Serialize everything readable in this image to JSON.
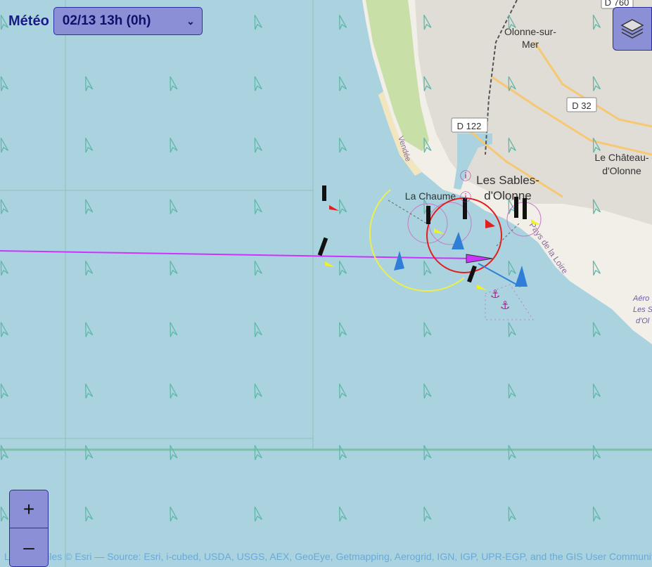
{
  "meteo": {
    "label": "Météo",
    "selected": "02/13 13h (0h)"
  },
  "map": {
    "places": {
      "olonne": "Olonne-sur-",
      "olonne2": "Mer",
      "sables": "Les Sables-",
      "sables2": "d'Olonne",
      "chaume": "La Chaume",
      "chateau": "Le Château-",
      "chateau2": "d'Olonne",
      "vendee": "Vendée",
      "loire": "Pays de la Loire",
      "aero": "Aéro",
      "aero2": "Les S",
      "aero3": "d'Ol"
    },
    "roads": {
      "d760": "D 760",
      "d32": "D 32",
      "d122": "D 122"
    },
    "wind_arrows": {
      "rows": 9,
      "cols": 8
    }
  },
  "zoom": {
    "in": "+",
    "out": "–"
  },
  "layers_icon": "layers-icon",
  "attribution": "Leaflet | Tiles © Esri — Source: Esri, i-cubed, USDA, USGS, AEX, GeoEye, Getmapping, Aerogrid, IGN, IGP, UPR-EGP, and the GIS User Community",
  "colors": {
    "sea": "#aad3df",
    "land": "#f2efe9",
    "track": "#cc33ff",
    "control": "#8b8fd6"
  }
}
